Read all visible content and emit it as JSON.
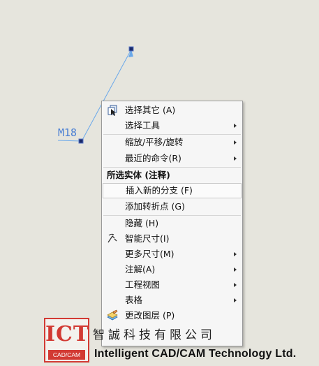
{
  "dimension": {
    "label": "M18",
    "color": "#4a7fd4"
  },
  "menu": {
    "items_top": [
      {
        "label": "选择其它 (A)",
        "icon": "select-other-icon",
        "submenu": false
      },
      {
        "label": "选择工具",
        "submenu": true
      }
    ],
    "items_view": [
      {
        "label": "缩放/平移/旋转",
        "submenu": true
      },
      {
        "label": "最近的命令(R)",
        "submenu": true
      }
    ],
    "section_header": "所选实体 (注释)",
    "items_entity": [
      {
        "label": "插入新的分支 (F)",
        "highlighted": true
      },
      {
        "label": "添加转折点 (G)"
      }
    ],
    "items_bottom": [
      {
        "label": "隐藏 (H)"
      },
      {
        "label": "智能尺寸(I)",
        "icon": "smart-dimension-icon"
      },
      {
        "label": "更多尺寸(M)",
        "submenu": true
      },
      {
        "label": "注解(A)",
        "submenu": true
      },
      {
        "label": "工程视图",
        "submenu": true
      },
      {
        "label": "表格",
        "submenu": true
      },
      {
        "label": "更改图层 (P)",
        "icon": "change-layer-icon"
      }
    ]
  },
  "logo": {
    "mark": "ICT",
    "mark_sub": "CAD/CAM",
    "company_cn": "智誠科技有限公司",
    "company_en": "Intelligent CAD/CAM Technology Ltd.",
    "brand_color": "#d23a33"
  }
}
